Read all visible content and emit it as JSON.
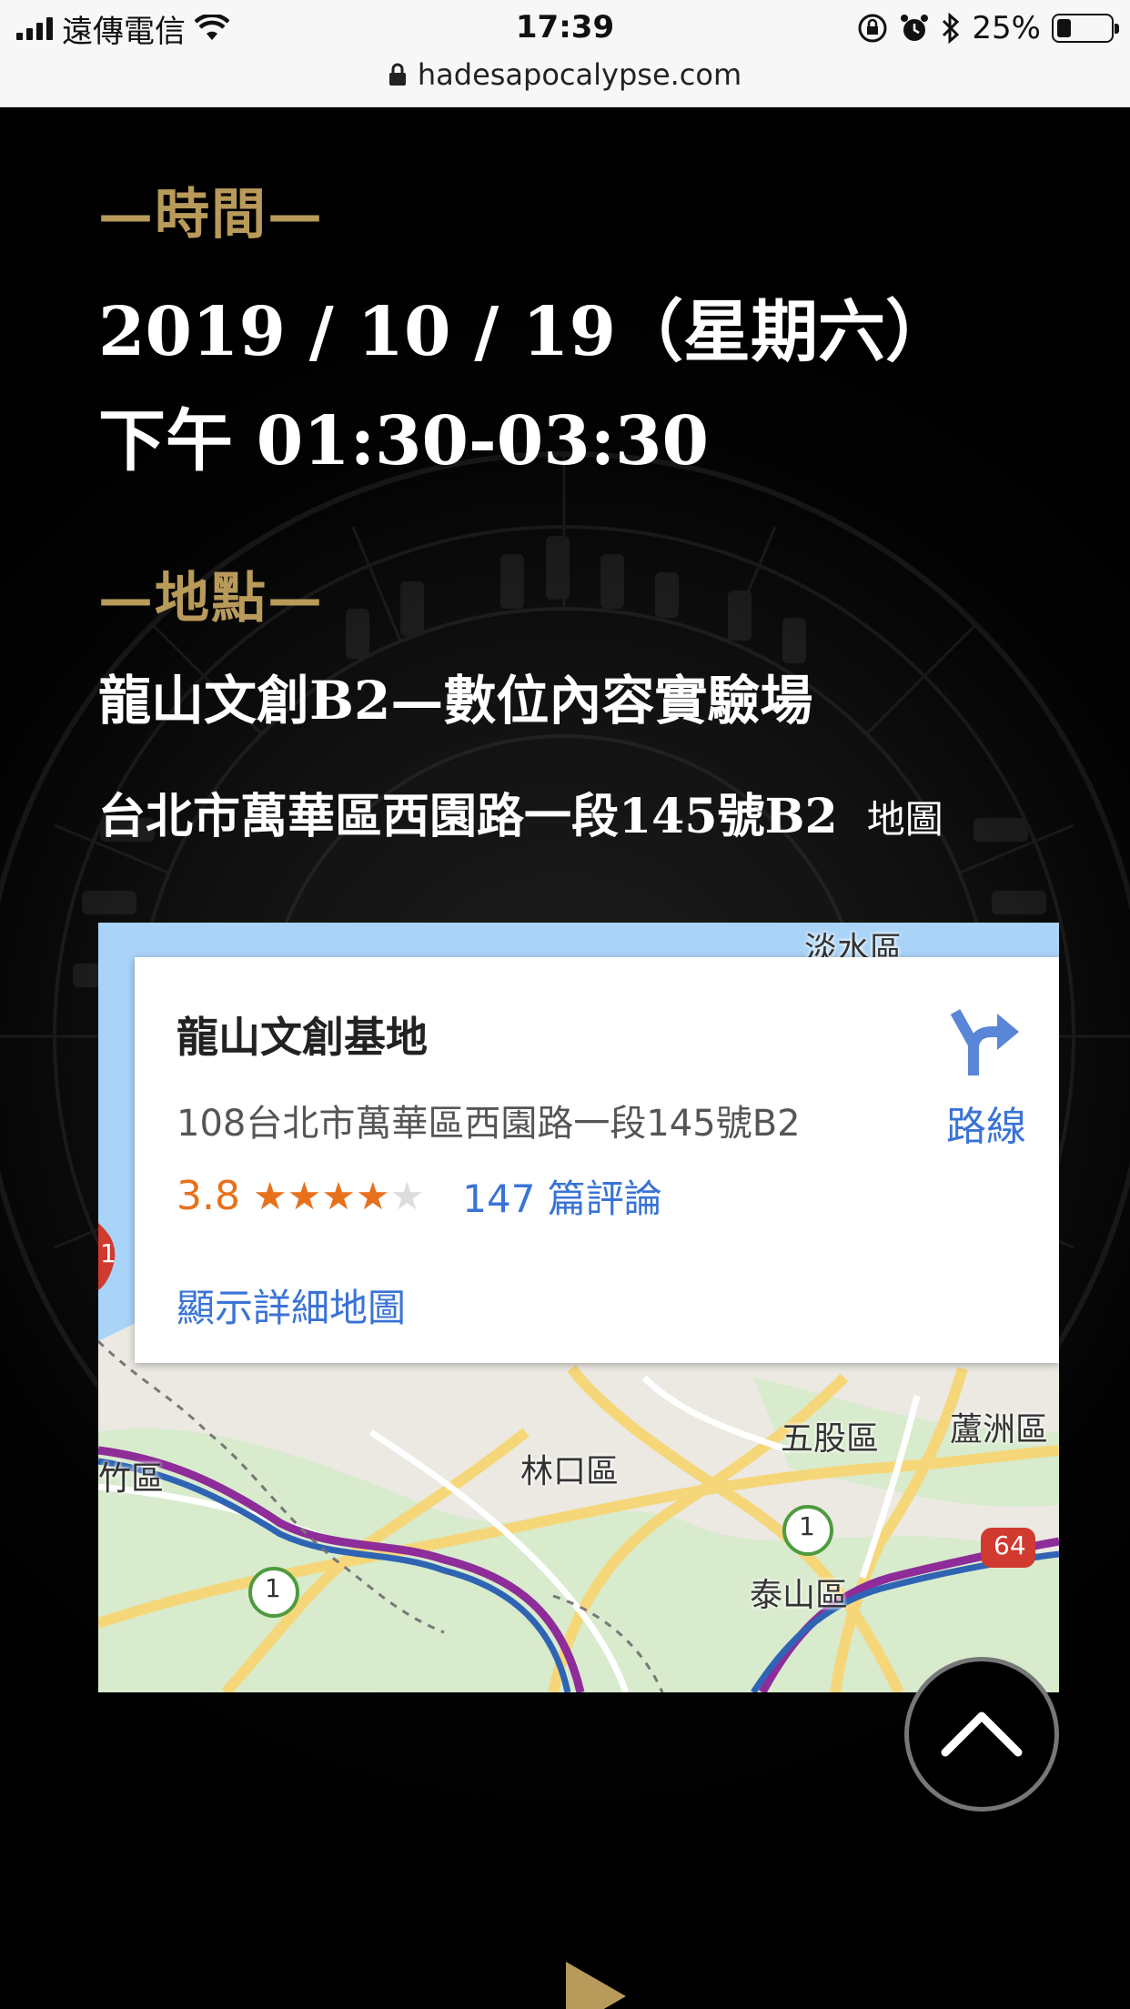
{
  "status_bar": {
    "carrier": "遠傳電信",
    "time": "17:39",
    "battery_text": "25%",
    "battery_level": 0.25,
    "url": "hadesapocalypse.com",
    "icons": [
      "signal-icon",
      "wifi-icon",
      "rotation-lock-icon",
      "alarm-icon",
      "bluetooth-icon",
      "battery-icon",
      "lock-icon"
    ]
  },
  "event": {
    "time_heading": "—時間—",
    "date_line": "2019 / 10 / 19（星期六）",
    "time_line": "下午 01:30-03:30",
    "location_heading": "—地點—",
    "venue": "龍山文創B2—數位內容實驗場",
    "address": "台北市萬華區西園路一段145號B2",
    "map_link": "地圖"
  },
  "map": {
    "place_name": "龍山文創基地",
    "place_address": "108台北市萬華區西園路一段145號B2",
    "rating": "3.8",
    "rating_value": 3.8,
    "stars": 5,
    "reviews": "147 篇評論",
    "detail_link": "顯示詳細地圖",
    "directions_label": "路線",
    "labels": {
      "danshui": "淡水區",
      "wugu": "五股區",
      "luzhou": "蘆洲區",
      "linkou": "林口區",
      "taishan": "泰山區",
      "zhuwei": "竹區"
    },
    "shield_1": "1",
    "shield_64": "64"
  },
  "colors": {
    "background": "#000000",
    "gold": "#b89a5a",
    "link_blue": "#3a73d6",
    "rating_orange": "#e7711b"
  }
}
